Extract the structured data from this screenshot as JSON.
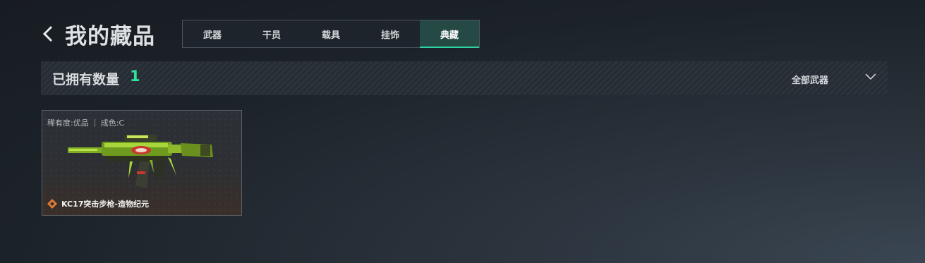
{
  "header": {
    "title": "我的藏品"
  },
  "tabs": [
    {
      "label": "武器"
    },
    {
      "label": "干员"
    },
    {
      "label": "载具"
    },
    {
      "label": "挂饰"
    },
    {
      "label": "典藏"
    }
  ],
  "active_tab": "典藏",
  "owned": {
    "label": "已拥有数量",
    "count": "1"
  },
  "filter": {
    "label": "全部武器"
  },
  "items": [
    {
      "rarity": "稀有度:优品",
      "condition": "成色:C",
      "name": "KC17突击步枪-造物纪元",
      "icon": "rarity-diamond-icon"
    }
  ],
  "colors": {
    "accent": "#2fe39d",
    "active_tab_bg": "#254a46",
    "rarity_orange": "#e07a3a"
  }
}
